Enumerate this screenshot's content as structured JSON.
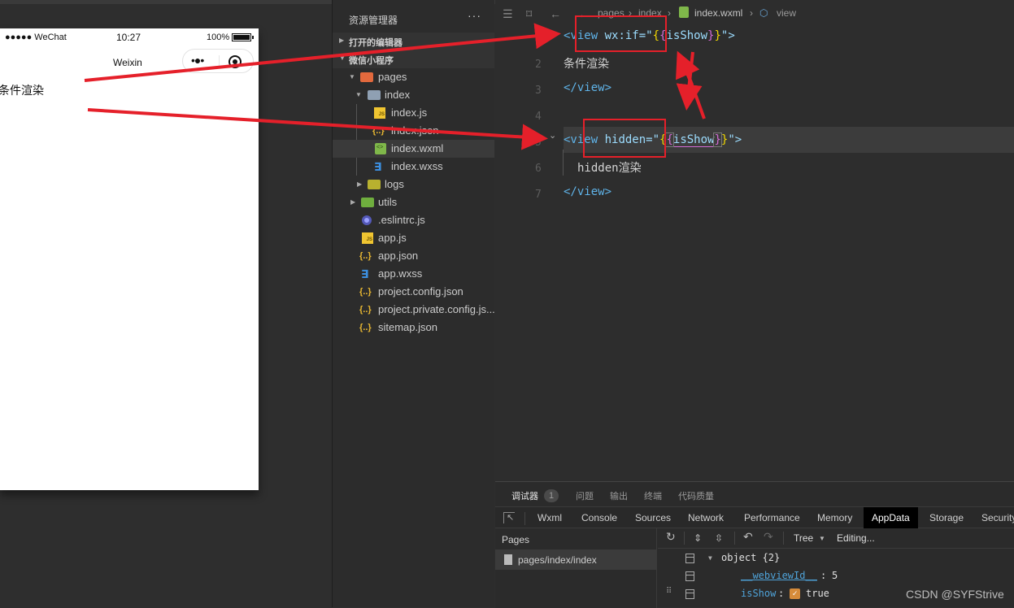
{
  "simulator": {
    "carrier": "●●●●● WeChat",
    "time": "10:27",
    "battery": "100%",
    "nav_title": "Weixin",
    "capsule_more": "•●•",
    "content_text": "条件渲染"
  },
  "explorer": {
    "title": "资源管理器",
    "more": "···",
    "sections": [
      {
        "label": "打开的编辑器"
      },
      {
        "label": "微信小程序"
      }
    ],
    "tree": [
      {
        "name": "pages",
        "type": "folder",
        "expanded": true
      },
      {
        "name": "index",
        "type": "folder",
        "expanded": true
      },
      {
        "name": "index.js",
        "type": "js"
      },
      {
        "name": "index.json",
        "type": "json"
      },
      {
        "name": "index.wxml",
        "type": "wxml",
        "selected": true
      },
      {
        "name": "index.wxss",
        "type": "wxss"
      },
      {
        "name": "logs",
        "type": "folder",
        "expanded": false
      },
      {
        "name": "utils",
        "type": "folder",
        "expanded": false
      },
      {
        "name": ".eslintrc.js",
        "type": "eslint"
      },
      {
        "name": "app.js",
        "type": "js"
      },
      {
        "name": "app.json",
        "type": "json"
      },
      {
        "name": "app.wxss",
        "type": "wxss"
      },
      {
        "name": "project.config.json",
        "type": "json"
      },
      {
        "name": "project.private.config.js...",
        "type": "json"
      },
      {
        "name": "sitemap.json",
        "type": "json"
      }
    ],
    "icon_glyphs": {
      "js": "JS",
      "json": "{..}",
      "wxss": "∃"
    }
  },
  "editor": {
    "breadcrumb": [
      "pages",
      "index",
      "index.wxml",
      "view"
    ],
    "line_numbers": [
      "1",
      "2",
      "3",
      "4",
      "5",
      "6",
      "7"
    ],
    "code": {
      "l1_tag_open": "<view",
      "l1_attr": " wx:if=\"",
      "l1_b1": "{",
      "l1_b2": "{",
      "l1_var": "isShow",
      "l1_b3": "}",
      "l1_b4": "}",
      "l1_end": "\">",
      "l2_text": "条件渲染",
      "l3_close": "</view>",
      "l5_tag_open": "<view",
      "l5_attr": " hidden=\"",
      "l5_b1": "{",
      "l5_b2": "{",
      "l5_var": "isShow",
      "l5_b3": "}",
      "l5_b4": "}",
      "l5_end": "\">",
      "l6_text": "hidden渲染",
      "l7_close": "</view>"
    }
  },
  "panel": {
    "tabs": [
      "调试器",
      "问题",
      "输出",
      "终端",
      "代码质量"
    ],
    "badge": "1",
    "devtools_tabs": [
      "Wxml",
      "Console",
      "Sources",
      "Network",
      "Performance",
      "Memory",
      "AppData",
      "Storage",
      "Security"
    ],
    "active_devtools_tab": "AppData",
    "pages_header": "Pages",
    "pages": [
      "pages/index/index"
    ],
    "appdata_toolbar": {
      "view_mode": "Tree",
      "status": "Editing..."
    },
    "tree": {
      "root": "object {2}",
      "entries": [
        {
          "key": "__webviewId__",
          "value": "5"
        },
        {
          "key": "isShow",
          "value": "true",
          "checked": true
        }
      ]
    }
  },
  "watermark": "CSDN @SYFStrive",
  "colors": {
    "annotation_red": "#e5202a",
    "active_tab_bg": "#000000",
    "checkbox": "#d68b3a"
  }
}
